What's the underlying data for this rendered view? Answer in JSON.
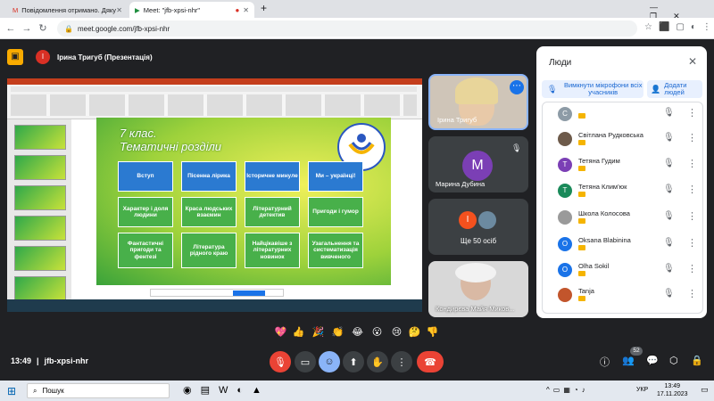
{
  "browser": {
    "tabs": [
      {
        "label": "Повідомлення отримано. Дяку"
      },
      {
        "label": "Meet: \"jfb-xpsi-nhr\""
      }
    ],
    "url": "meet.google.com/jfb-xpsi-nhr"
  },
  "presenter": {
    "label": "Ірина Тригуб (Презентація)",
    "initial": "І"
  },
  "slide": {
    "title_line1": "7 клас.",
    "title_line2": "Тематичні розділи",
    "tiles": [
      "Вступ",
      "Пісенна лірика",
      "Історичне минуле",
      "Ми – українці!",
      "Характер і доля людини",
      "Краса людських взаємин",
      "Літературний детектив",
      "Пригоди і гумор",
      "Фантастичні пригоди та фентезі",
      "Література рідного краю",
      "Найцікавіше з літературних новинок",
      "Узагальнення та систематизація вивченого"
    ]
  },
  "participants_tiles": [
    {
      "name": "Ірина Тригуб"
    },
    {
      "name": "Марина Дубина",
      "initial": "M"
    },
    {
      "name": "Ще 50 осіб",
      "initial": "І"
    },
    {
      "name": "Кондирєва Майя Миков..."
    }
  ],
  "people_panel": {
    "title": "Люди",
    "mute_all": "Вимкнути мікрофони всіх учасників",
    "add_people": "Додати людей",
    "list": [
      {
        "name": "",
        "initial": "C",
        "color": "#8d9ba6"
      },
      {
        "name": "Світлана Рудковська",
        "initial": "",
        "color": "#6d5a4a"
      },
      {
        "name": "Тетяна Гудим",
        "initial": "Т",
        "color": "#7b3fb5"
      },
      {
        "name": "Тетяна Клим'юк",
        "initial": "Т",
        "color": "#1a8a5a"
      },
      {
        "name": "Школа Колосова",
        "initial": "",
        "color": "#9a9a9a"
      },
      {
        "name": "Oksana Blabinina",
        "initial": "O",
        "color": "#1a73e8"
      },
      {
        "name": "Olha Sokil",
        "initial": "O",
        "color": "#1a73e8"
      },
      {
        "name": "Tanja",
        "initial": "",
        "color": "#c2552c"
      }
    ]
  },
  "meeting": {
    "time": "13:49",
    "code": "jfb-xpsi-nhr",
    "people_count": "52"
  },
  "reactions": [
    "💖",
    "👍",
    "🎉",
    "👏",
    "😂",
    "😮",
    "😢",
    "🤔",
    "👎"
  ],
  "taskbar": {
    "search": "Пошук",
    "lang": "УКР",
    "time": "13:49",
    "date": "17.11.2023"
  }
}
